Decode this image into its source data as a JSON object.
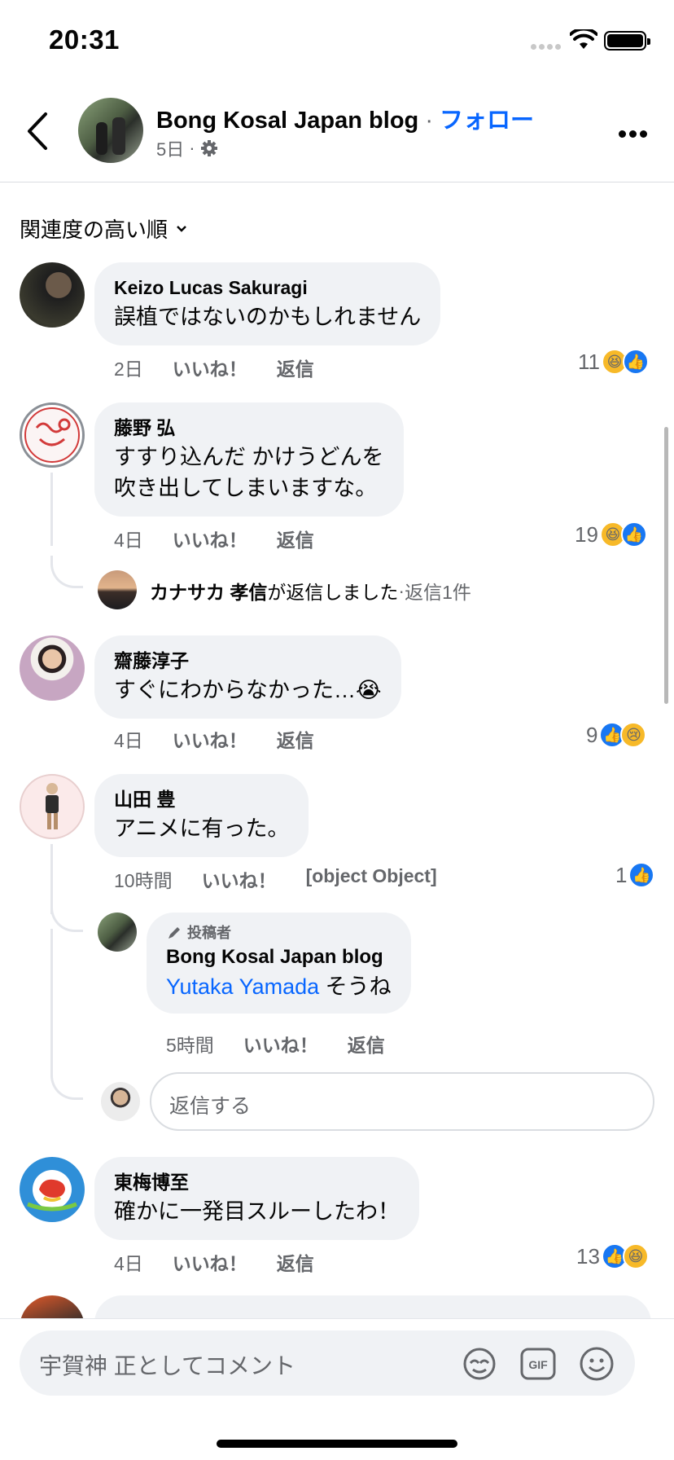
{
  "status": {
    "time": "20:31"
  },
  "header": {
    "page_name": "Bong Kosal Japan blog",
    "separator": "·",
    "follow": "フォロー",
    "age": "5日",
    "age_sep": "·"
  },
  "sort": {
    "label": "関連度の高い順"
  },
  "comments": [
    {
      "name": "Keizo Lucas Sakuragi",
      "text": "誤植ではないのかもしれません",
      "time": "2日",
      "like": "いいね！",
      "reply": "返信",
      "count": "11"
    },
    {
      "name": "藤野 弘",
      "text1": "すすり込んだ かけうどんを",
      "text2": "吹き出してしまいますな。",
      "time": "4日",
      "like": "いいね！",
      "reply": "返信",
      "count": "19",
      "reply_summary": {
        "name": "カナサカ 孝信",
        "action": "が返信しました",
        "sep": " · ",
        "count": "返信1件"
      }
    },
    {
      "name": "齋藤淳子",
      "text": "すぐにわからなかった…😭",
      "time": "4日",
      "like": "いいね！",
      "reply": "返信",
      "count": "9"
    },
    {
      "name": "山田 豊",
      "text": "アニメに有った。",
      "time": "10時間",
      "like": "いいね！",
      "reply": {
        "badge": "投稿者",
        "name": "Bong Kosal Japan blog",
        "tag": "Yutaka Yamada",
        "text": " そうね",
        "time": "5時間",
        "like": "いいね！",
        "reply": "返信"
      },
      "count": "1",
      "reply_placeholder": "返信する"
    },
    {
      "name": "東梅博至",
      "text": "確かに一発目スルーしたわ！",
      "time": "4日",
      "like": "いいね！",
      "reply": "返信",
      "count": "13"
    }
  ],
  "composer": {
    "placeholder": "宇賀神 正としてコメント",
    "gif": "GIF"
  },
  "colors": {
    "accent": "#0866ff",
    "bubble": "#f0f2f5",
    "muted": "#65676b"
  },
  "icons": [
    "back-chevron-icon",
    "gear-icon",
    "more-icon",
    "chevron-down-icon",
    "like-icon",
    "haha-icon",
    "sad-icon",
    "pencil-icon",
    "avatar-sticker-icon",
    "gif-icon",
    "emoji-icon"
  ]
}
